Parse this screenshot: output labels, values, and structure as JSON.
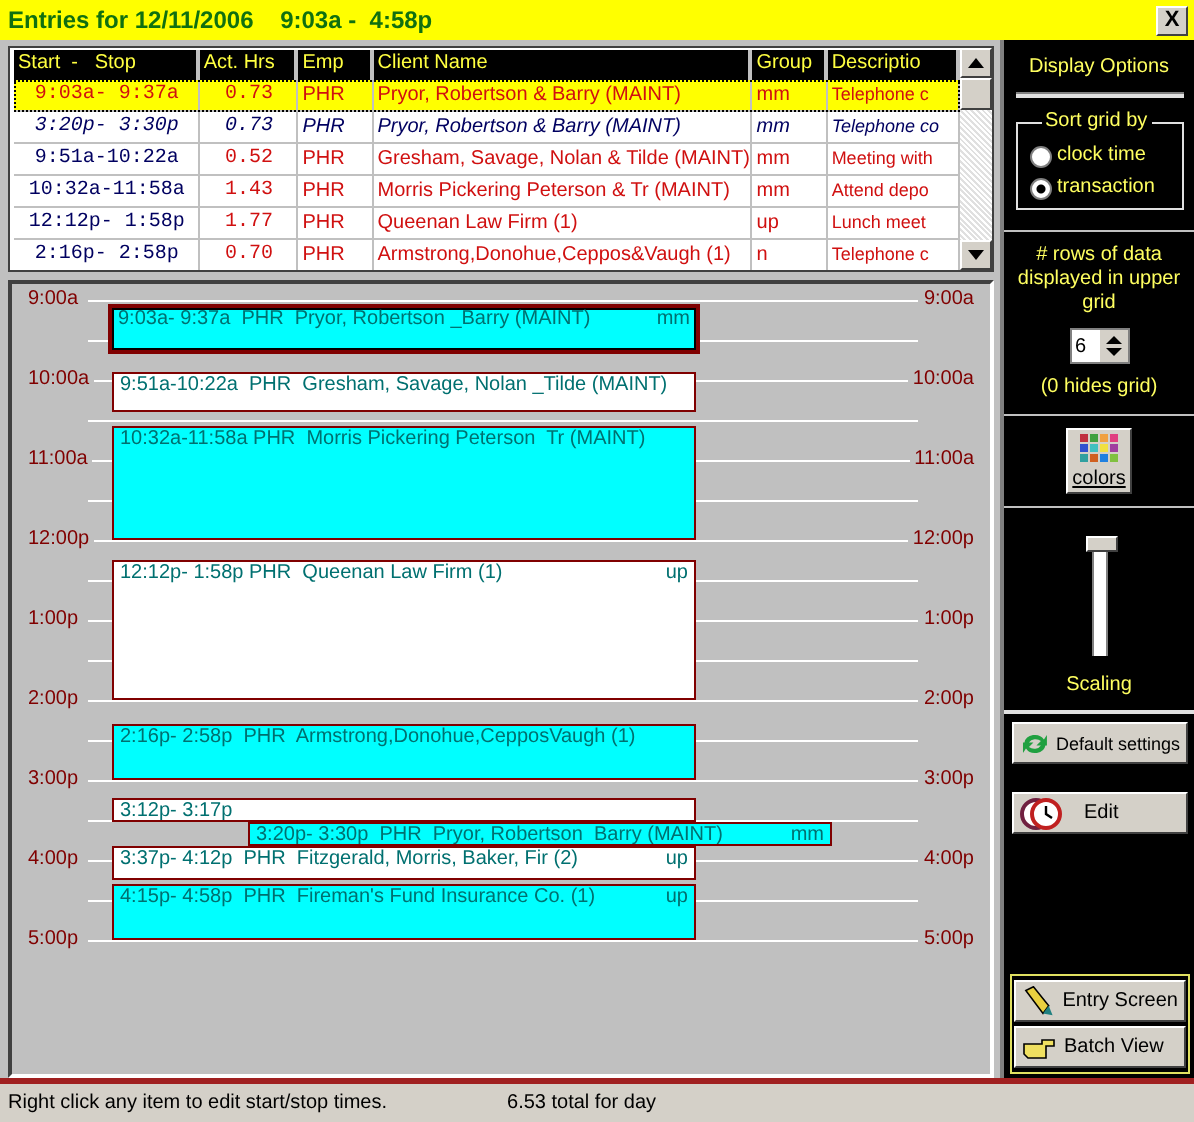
{
  "window": {
    "title": "Entries for 12/11/2006    9:03a -  4:58p",
    "close": "X"
  },
  "grid": {
    "columns": [
      "Start  -   Stop",
      "Act. Hrs",
      "Emp",
      "Client Name",
      "Group",
      "Descriptio"
    ],
    "rows": [
      {
        "start_stop": "9:03a- 9:37a",
        "act_hrs": "0.73",
        "emp": "PHR",
        "client_name": "Pryor, Robertson & Barry (MAINT)",
        "group": "mm",
        "description": "Telephone c",
        "selected": true,
        "kind": "standard"
      },
      {
        "start_stop": "3:20p- 3:30p",
        "act_hrs": "0.73",
        "emp": "PHR",
        "client_name": "Pryor, Robertson & Barry (MAINT)",
        "group": "mm",
        "description": "Telephone co",
        "selected": false,
        "kind": "italic"
      },
      {
        "start_stop": "9:51a-10:22a",
        "act_hrs": "0.52",
        "emp": "PHR",
        "client_name": "Gresham, Savage, Nolan & Tilde (MAINT)",
        "group": "mm",
        "description": "Meeting with",
        "selected": false,
        "kind": "standard"
      },
      {
        "start_stop": "10:32a-11:58a",
        "act_hrs": "1.43",
        "emp": "PHR",
        "client_name": "Morris Pickering Peterson & Tr (MAINT)",
        "group": "mm",
        "description": "Attend depo",
        "selected": false,
        "kind": "standard"
      },
      {
        "start_stop": "12:12p- 1:58p",
        "act_hrs": "1.77",
        "emp": "PHR",
        "client_name": "Queenan Law Firm (1)",
        "group": "up",
        "description": "Lunch meet",
        "selected": false,
        "kind": "standard"
      },
      {
        "start_stop": "2:16p- 2:58p",
        "act_hrs": "0.70",
        "emp": "PHR",
        "client_name": "Armstrong,Donohue,Ceppos&Vaugh (1)",
        "group": "n",
        "description": "Telephone c",
        "selected": false,
        "kind": "standard"
      }
    ]
  },
  "timeline": {
    "hours_left": [
      "9:00a",
      "10:00a",
      "11:00a",
      "12:00p",
      "1:00p",
      "2:00p",
      "3:00p",
      "4:00p",
      "5:00p"
    ],
    "hours_right": [
      "9:00a",
      "10:00a",
      "11:00a",
      "12:00p",
      "1:00p",
      "2:00p",
      "3:00p",
      "4:00p",
      "5:00p"
    ],
    "events": [
      {
        "text": "9:03a- 9:37a  PHR  Pryor, Robertson _Barry (MAINT)",
        "group": "mm",
        "color": "#00ffff",
        "selected": true
      },
      {
        "text": "9:51a-10:22a  PHR  Gresham, Savage, Nolan _Tilde (MAINT)",
        "color": "#ffffff",
        "selected": false
      },
      {
        "text": "10:32a-11:58a PHR  Morris Pickering Peterson  Tr (MAINT)",
        "color": "#00ffff",
        "selected": false
      },
      {
        "text": "12:12p- 1:58p PHR  Queenan Law Firm (1)",
        "group": "up",
        "color": "#ffffff",
        "selected": false
      },
      {
        "text": "2:16p- 2:58p  PHR  Armstrong,Donohue,CepposVaugh (1)",
        "color": "#00ffff",
        "selected": false
      },
      {
        "text": "3:12p- 3:17p",
        "color": "#ffffff",
        "selected": false
      },
      {
        "text": "3:20p- 3:30p  PHR  Pryor, Robertson  Barry (MAINT)",
        "group": "mm",
        "color": "#00ffff",
        "selected": false
      },
      {
        "text": "3:37p- 4:12p  PHR  Fitzgerald, Morris, Baker, Fir (2)",
        "group": "up",
        "color": "#ffffff",
        "selected": false
      },
      {
        "text": "4:15p- 4:58p  PHR  Fireman's Fund Insurance Co. (1)",
        "group": "up",
        "color": "#00ffff",
        "selected": false
      }
    ]
  },
  "options": {
    "title": "Display Options",
    "sort_label": "Sort grid by",
    "sort_options": [
      {
        "label": "clock time",
        "selected": false
      },
      {
        "label": "transaction",
        "selected": true
      }
    ],
    "rows_label": "# rows of data displayed in upper grid",
    "rows_value": "6",
    "rows_hint": "(0 hides grid)",
    "colors_button": "colors",
    "scaling": {
      "label": "Scaling",
      "level": 1
    },
    "buttons": [
      "Default settings",
      "Edit"
    ],
    "nav_buttons": [
      "Entry Screen",
      "Batch View"
    ]
  },
  "status_bar": {
    "message": "Right click any item to edit start/stop times.",
    "total": "6.53 total for day"
  }
}
